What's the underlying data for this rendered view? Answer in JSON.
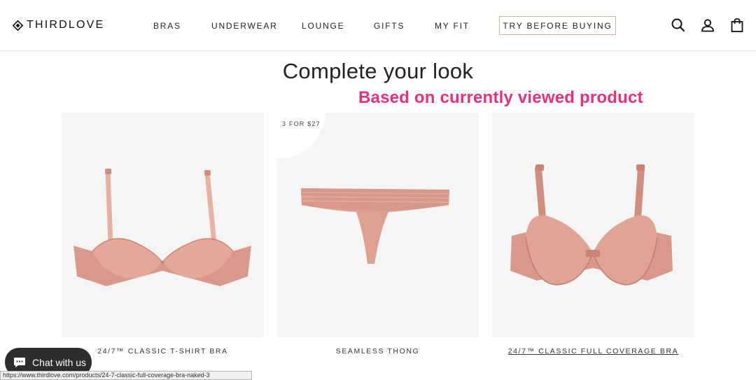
{
  "brand": {
    "name": "THIRDLOVE"
  },
  "nav": {
    "items": [
      "BRAS",
      "UNDERWEAR",
      "LOUNGE",
      "GIFTS",
      "MY FIT"
    ],
    "cta": "TRY BEFORE BUYING"
  },
  "header_icons": [
    "search-icon",
    "account-icon",
    "shopping-bag-icon"
  ],
  "section": {
    "title": "Complete your look",
    "annotation": "Based on currently viewed product"
  },
  "products": [
    {
      "name": "24/7™ CLASSIC T-SHIRT BRA",
      "badge": ""
    },
    {
      "name": "SEAMLESS THONG",
      "badge": "3 FOR $27"
    },
    {
      "name": "24/7™ CLASSIC FULL COVERAGE BRA",
      "badge": ""
    }
  ],
  "chat": {
    "label": "Chat with us"
  },
  "status_bar": {
    "url": "https://www.thirdlove.com/products/24-7-classic-full-coverage-bra-naked-3"
  },
  "colors": {
    "product_tone": "#d9998a",
    "cta_border": "#d9b3a0",
    "annotation": "#ea2f7c",
    "chat_bg": "#2d2d2d"
  }
}
